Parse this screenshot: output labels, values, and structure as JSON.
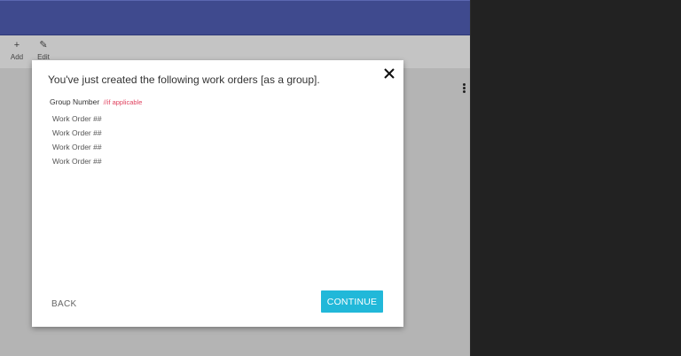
{
  "toolbar": {
    "add": {
      "icon": "+",
      "label": "Add"
    },
    "edit": {
      "icon": "✎",
      "label": "Edit"
    }
  },
  "modal": {
    "title": "You've just created the following work orders [as a group].",
    "group_label": "Group Number",
    "group_note": "//if applicable",
    "work_orders": [
      "Work Order ##",
      "Work Order ##",
      "Work Order ##",
      "Work Order ##"
    ],
    "back_label": "BACK",
    "continue_label": "CONTINUE"
  },
  "colors": {
    "appbar": "#3f4a8e",
    "accent": "#21b8d9",
    "note": "#e0415e",
    "right_pane": "#222222"
  },
  "icons": [
    "plus-icon",
    "pencil-icon",
    "more-vert-icon",
    "close-icon"
  ]
}
